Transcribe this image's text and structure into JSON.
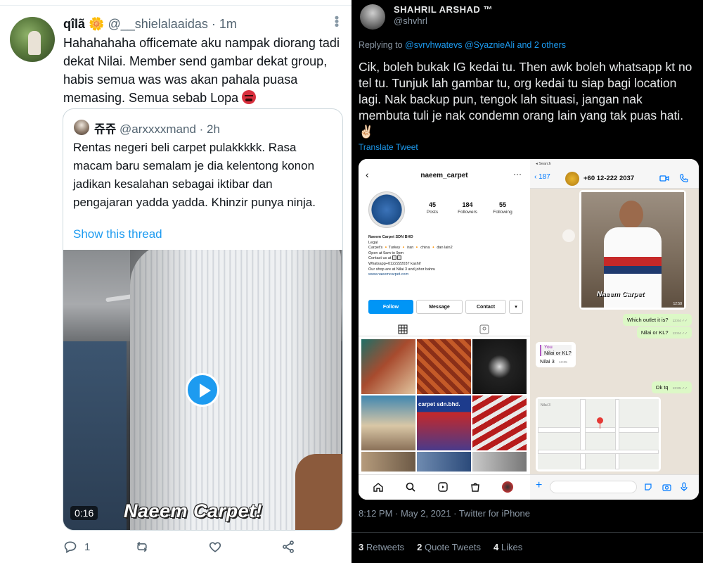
{
  "left_tweet": {
    "display_name": "qîlã",
    "flower_emoji": "🌼",
    "handle": "@__shielalaaidas",
    "time": "1m",
    "text": "Hahahahaha officemate aku nampak diorang tadi dekat Nilai. Member send gambar dekat group, habis semua was was akan pahala puasa memasing. Semua sebab Lopa",
    "quote": {
      "display_name": "쥬쥬",
      "handle": "@arxxxxmand",
      "time": "2h",
      "text": "Rentas negeri beli carpet pulakkkkk. Rasa macam baru semalam je dia kelentong konon jadikan kesalahan sebagai iktibar dan pengajaran yadda yadda. Khinzir punya ninja.",
      "show_thread": "Show this thread",
      "video": {
        "duration": "0:16",
        "caption": "Naeem Carpet!"
      }
    },
    "actions": {
      "reply_count": "1",
      "retweet_count": "",
      "like_count": ""
    }
  },
  "right_tweet": {
    "display_name": "SHAHRIL ARSHAD ™",
    "handle": "@shvhrl",
    "replying_prefix": "Replying to",
    "replying_to": "@svrvhwatevs @SyaznieAli and 2 others",
    "text": "Cik, boleh bukak IG kedai tu. Then awk boleh whatsapp kt no tel tu. Tunjuk lah gambar tu, org kedai tu siap bagi location lagi. Nak backup pun, tengok lah situasi, jangan nak membuta tuli je nak condemn orang lain yang tak puas hati. ✌🏻",
    "translate": "Translate Tweet",
    "meta": "8:12 PM · May 2, 2021 · Twitter for iPhone",
    "stats": {
      "retweets_count": "3",
      "retweets_label": "Retweets",
      "quotes_count": "2",
      "quotes_label": "Quote Tweets",
      "likes_count": "4",
      "likes_label": "Likes"
    },
    "instagram": {
      "username": "naeem_carpet",
      "posts": "45",
      "posts_label": "Posts",
      "followers": "184",
      "followers_label": "Followers",
      "following": "55",
      "following_label": "Following",
      "bio_name": "Naeem Carpet SDN BHD",
      "bio_lines": [
        "Legal",
        "Carpet's 🔸Turkey 🔸 iran 🔸 china 🔸 dan lain2",
        "Open at 9am to 9pm",
        "Contact us at 🔲🔲",
        "Whatsapp+0122222037 kashif",
        "Our shop are at Nilai 3 and johor bahru"
      ],
      "bio_link": "www.naeemcarpet.com",
      "follow_label": "Follow",
      "message_label": "Message",
      "contact_label": "Contact",
      "tile_text": "carpet sdn.bhd."
    },
    "whatsapp": {
      "search_label": "◂ Search",
      "back_count": "187",
      "phone": "+60 12-222 2037",
      "image_watermark": "Naeem Carpet",
      "image_time": "12:58",
      "msg1": "Which outlet it is?",
      "msg1_time": "13:04 ✓✓",
      "msg2": "Nilai or KL?",
      "msg2_time": "13:04 ✓✓",
      "reply_who": "You",
      "reply_quoted": "Nilai or KL?",
      "reply_text": "Nilai 3",
      "reply_time": "13:05",
      "msg3": "Ok tq",
      "msg3_time": "13:05 ✓✓",
      "map_label": "Nilai 3"
    }
  },
  "colors": {
    "twitter_blue": "#1d9bf0",
    "light_text_secondary": "#536471",
    "dark_text_secondary": "#8b98a5",
    "whatsapp_outgoing": "#dcf8c6",
    "instagram_follow": "#0095f6"
  }
}
